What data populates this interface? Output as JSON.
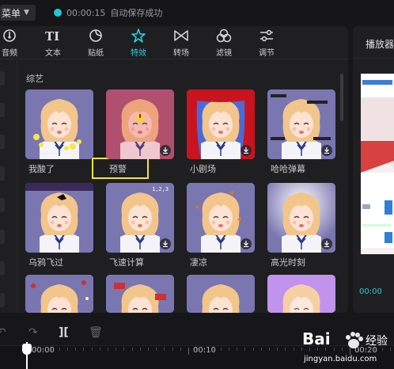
{
  "header": {
    "menu_label": "菜单",
    "save_time": "00:00:15",
    "save_text": "自动保存成功"
  },
  "tabs": [
    {
      "label": "音频",
      "icon": "music-icon",
      "active": false
    },
    {
      "label": "文本",
      "icon": "text-icon",
      "active": false
    },
    {
      "label": "贴纸",
      "icon": "sticker-icon",
      "active": false
    },
    {
      "label": "特效",
      "icon": "sparkle-icon",
      "active": true
    },
    {
      "label": "转场",
      "icon": "transition-icon",
      "active": false
    },
    {
      "label": "滤镜",
      "icon": "filter-icon",
      "active": false
    },
    {
      "label": "调节",
      "icon": "adjust-icon",
      "active": false
    }
  ],
  "section_title": "综艺",
  "effects": [
    {
      "label": "我酸了",
      "style": "yellow-sparkles",
      "download": false
    },
    {
      "label": "预警",
      "style": "red-alert",
      "download": true,
      "highlighted": true
    },
    {
      "label": "小剧场",
      "style": "red-curtain",
      "download": true
    },
    {
      "label": "哈哈弹幕",
      "style": "dark-text",
      "download": true
    },
    {
      "label": "乌鸦飞过",
      "style": "crow",
      "download": false
    },
    {
      "label": "飞速计算",
      "style": "numbers",
      "download": true
    },
    {
      "label": "凄凉",
      "style": "leaves",
      "download": true
    },
    {
      "label": "高光时刻",
      "style": "glow",
      "download": true
    },
    {
      "label": "",
      "style": "confetti",
      "download": false
    },
    {
      "label": "",
      "style": "blocks",
      "download": false
    },
    {
      "label": "",
      "style": "plain",
      "download": false
    },
    {
      "label": "",
      "style": "purple-burst",
      "download": false
    }
  ],
  "player": {
    "title": "播放器",
    "time": "00:00"
  },
  "timeline": {
    "ruler_labels": [
      "00:00",
      "00:10",
      "00:20"
    ]
  },
  "watermark": {
    "brand": "Bai",
    "brand_suffix": "经验",
    "url": "jingyan.baidu.com"
  },
  "colors": {
    "accent": "#2ad3e0",
    "highlight_box": "#f4e531",
    "card_bg": "#7a76b0"
  }
}
